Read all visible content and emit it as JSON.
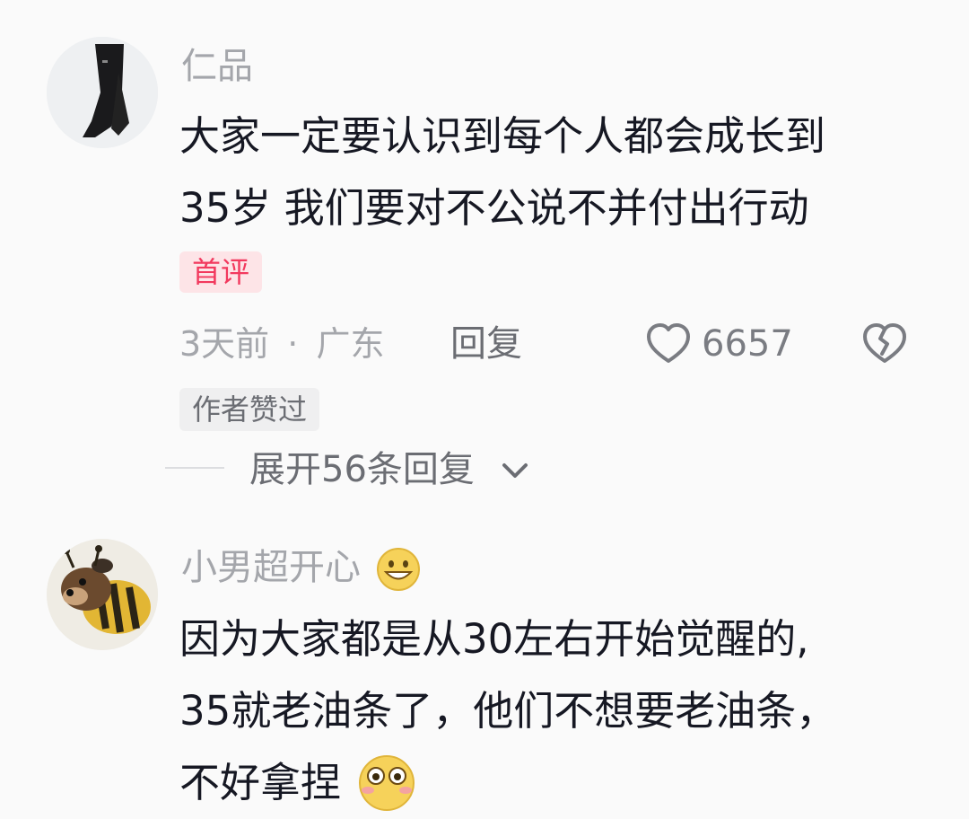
{
  "comments": [
    {
      "username": "仁品",
      "text_line1": "大家一定要认识到每个人都会成长到",
      "text_line2": "35岁 我们要对不公说不并付出行动",
      "badge": "首评",
      "time": "3天前",
      "dot": "·",
      "location": "广东",
      "reply_label": "回复",
      "likes": "6657",
      "author_liked": "作者赞过",
      "expand_label": "展开56条回复"
    },
    {
      "username": "小男超开心",
      "text_line1": "因为大家都是从30左右开始觉醒的,",
      "text_line2": "35就老油条了，他们不想要老油条，",
      "text_line3": "不好拿捏"
    }
  ],
  "icons": {
    "like": "heart-outline-icon",
    "dislike": "broken-heart-icon",
    "expand": "chevron-down-icon",
    "emoji_smile": "grinning-face-icon",
    "emoji_flushed": "flushed-face-icon"
  },
  "colors": {
    "background": "#fafafa",
    "text_primary": "#161823",
    "text_secondary": "#a4a6ab",
    "badge_red": "#f2395e",
    "badge_red_bg": "#fde4e7"
  }
}
